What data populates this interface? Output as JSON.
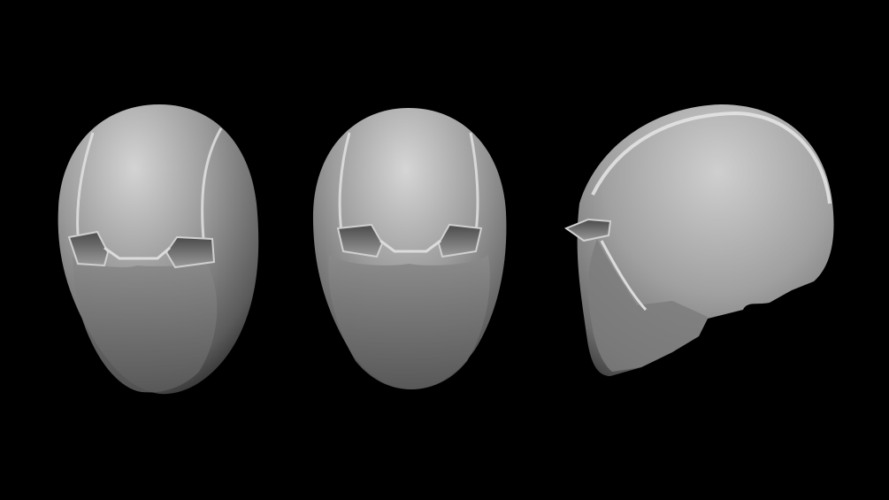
{
  "scene": {
    "background_color": "#000000",
    "material_light": "#cfcfcf",
    "material_mid": "#8e8e8e",
    "material_dark": "#3a3a3a",
    "eye_slot_color": "#6a6a6a",
    "views": [
      {
        "id": "front-tilted",
        "view": "front"
      },
      {
        "id": "front",
        "view": "front"
      },
      {
        "id": "side",
        "view": "side"
      }
    ]
  }
}
